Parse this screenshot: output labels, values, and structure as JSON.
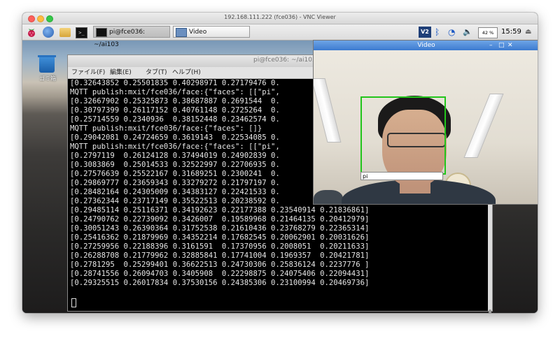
{
  "window": {
    "title": "192.168.111.222 (fce036) - VNC Viewer"
  },
  "taskbar": {
    "tasks": [
      {
        "label": "pi@fce036: ~/ai103"
      },
      {
        "label": "Video"
      }
    ],
    "tray": {
      "vnc_label": "V2",
      "cpu": "42 %",
      "clock": "15:59"
    }
  },
  "desktop": {
    "trash_label": "ゴミ箱"
  },
  "terminal": {
    "title": "pi@fce036: ~/ai103",
    "menus": [
      "ファイル(F)",
      "編集(E)",
      "タブ(T)",
      "ヘルプ(H)"
    ],
    "lines": [
      "[0.32643852 0.25501835 0.40298971 0.27179476 0.",
      "MQTT publish:mxit/fce036/face:{\"faces\": [[\"pi\",",
      "[0.32667902 0.25325873 0.38687887 0.2691544  0.",
      "[0.30797399 0.26117152 0.40761148 0.2725264  0.",
      "[0.25714559 0.2340936  0.38152448 0.23462574 0.",
      "MQTT publish:mxit/fce036/face:{\"faces\": []}",
      "[0.29042081 0.24724659 0.3619143  0.22534085 0.",
      "MQTT publish:mxit/fce036/face:{\"faces\": [[\"pi\",",
      "[0.2797119  0.26124128 0.37494019 0.24902839 0.",
      "[0.3083869  0.25014533 0.32522997 0.22706935 0.",
      "[0.27576639 0.25522167 0.31689251 0.2300241  0.",
      "[0.29869777 0.23659343 0.33279272 0.21797197 0.",
      "[0.28482164 0.24305009 0.34383127 0.22421533 0.",
      "[0.27362344 0.23717149 0.35522513 0.20238592 0.",
      "[0.29485114 0.25116371 0.34192623 0.22177388 0.23540914 0.21836861]",
      "[0.24790762 0.22739092 0.3426007  0.19589968 0.21464135 0.20412979]",
      "[0.30051243 0.26390364 0.31752538 0.21610436 0.23768279 0.22365314]",
      "[0.25416362 0.21879969 0.34352214 0.17682545 0.20062901 0.20031626]",
      "[0.27259956 0.22188396 0.3161591  0.17370956 0.2008051  0.20211633]",
      "[0.26288708 0.21779962 0.32885841 0.17741004 0.1969357  0.20421781]",
      "[0.2781295  0.25299401 0.36622513 0.24730306 0.25836124 0.2237776 ]",
      "[0.28741556 0.26094703 0.3405908  0.22298875 0.24075406 0.22094431]",
      "[0.29325515 0.26017834 0.37530156 0.24385306 0.23100994 0.20469736]"
    ]
  },
  "video": {
    "title": "Video",
    "face_label": "pi"
  }
}
